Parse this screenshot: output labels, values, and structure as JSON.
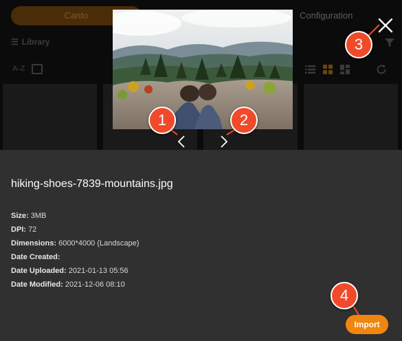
{
  "background_app": {
    "tab_active_label": "Canto",
    "tab_config_label": "Configuration",
    "library_label": "Library",
    "sort_label": "A-Z"
  },
  "viewer": {
    "prev_icon": "chevron-left-icon",
    "next_icon": "chevron-right-icon",
    "close_icon": "close-icon"
  },
  "callouts": [
    "1",
    "2",
    "3",
    "4"
  ],
  "details": {
    "file_name": "hiking-shoes-7839-mountains.jpg",
    "rows": [
      {
        "label": "Size:",
        "value": "3MB"
      },
      {
        "label": "DPI:",
        "value": "72"
      },
      {
        "label": "Dimensions:",
        "value": "6000*4000 (Landscape)"
      },
      {
        "label": "Date Created:",
        "value": ""
      },
      {
        "label": "Date Uploaded:",
        "value": "2021-01-13 05:56"
      },
      {
        "label": "Date Modified:",
        "value": "2021-12-06 08:10"
      }
    ],
    "import_label": "Import"
  },
  "colors": {
    "accent": "#f0860f",
    "callout": "#f04a2a",
    "panel": "#303030"
  }
}
